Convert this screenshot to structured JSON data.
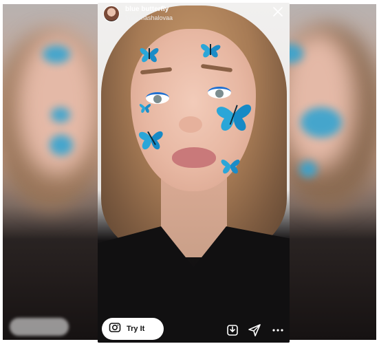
{
  "header": {
    "effect_name": "blue butterfly",
    "creator": "from mashalovaa"
  },
  "footer": {
    "try_it_label": "Try It"
  },
  "icons": {
    "close": "close-icon",
    "camera": "camera-icon",
    "save": "save-icon",
    "send": "send-icon",
    "more": "more-icon"
  },
  "colors": {
    "butterfly_blue": "#2aa6d8",
    "shirt": "#111011",
    "hair": "#a77b55"
  }
}
